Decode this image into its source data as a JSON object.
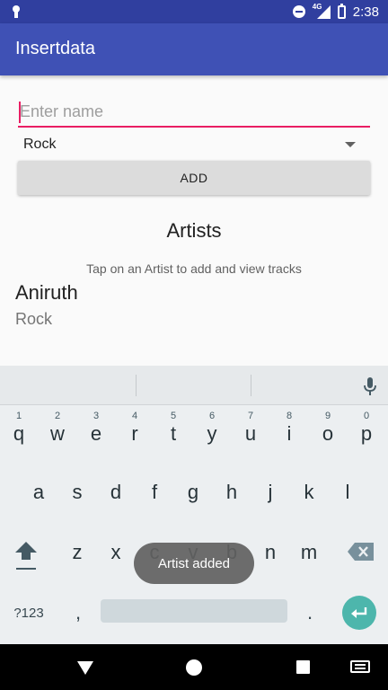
{
  "status_bar": {
    "time": "2:38",
    "network_label": "4G",
    "icons": [
      "keyhole-icon",
      "do-not-disturb-icon",
      "signal-icon",
      "battery-icon"
    ]
  },
  "app_bar": {
    "title": "Insertdata"
  },
  "form": {
    "name_placeholder": "Enter name",
    "name_value": "",
    "genre_selected": "Rock",
    "add_label": "ADD"
  },
  "artists": {
    "heading": "Artists",
    "hint": "Tap on an Artist to add and view tracks",
    "items": [
      {
        "name": "Aniruth",
        "genre": "Rock"
      }
    ]
  },
  "keyboard": {
    "row1": [
      {
        "ch": "q",
        "num": "1"
      },
      {
        "ch": "w",
        "num": "2"
      },
      {
        "ch": "e",
        "num": "3"
      },
      {
        "ch": "r",
        "num": "4"
      },
      {
        "ch": "t",
        "num": "5"
      },
      {
        "ch": "y",
        "num": "6"
      },
      {
        "ch": "u",
        "num": "7"
      },
      {
        "ch": "i",
        "num": "8"
      },
      {
        "ch": "o",
        "num": "9"
      },
      {
        "ch": "p",
        "num": "0"
      }
    ],
    "row2": [
      "a",
      "s",
      "d",
      "f",
      "g",
      "h",
      "j",
      "k",
      "l"
    ],
    "row3": [
      "z",
      "x",
      "c",
      "v",
      "b",
      "n",
      "m"
    ],
    "symbols_label": "?123",
    "comma": ",",
    "period": "."
  },
  "toast": {
    "message": "Artist added"
  },
  "colors": {
    "primary": "#3f51b5",
    "primary_dark": "#303f9f",
    "accent": "#e91e63",
    "enter_key": "#4db6ac"
  }
}
